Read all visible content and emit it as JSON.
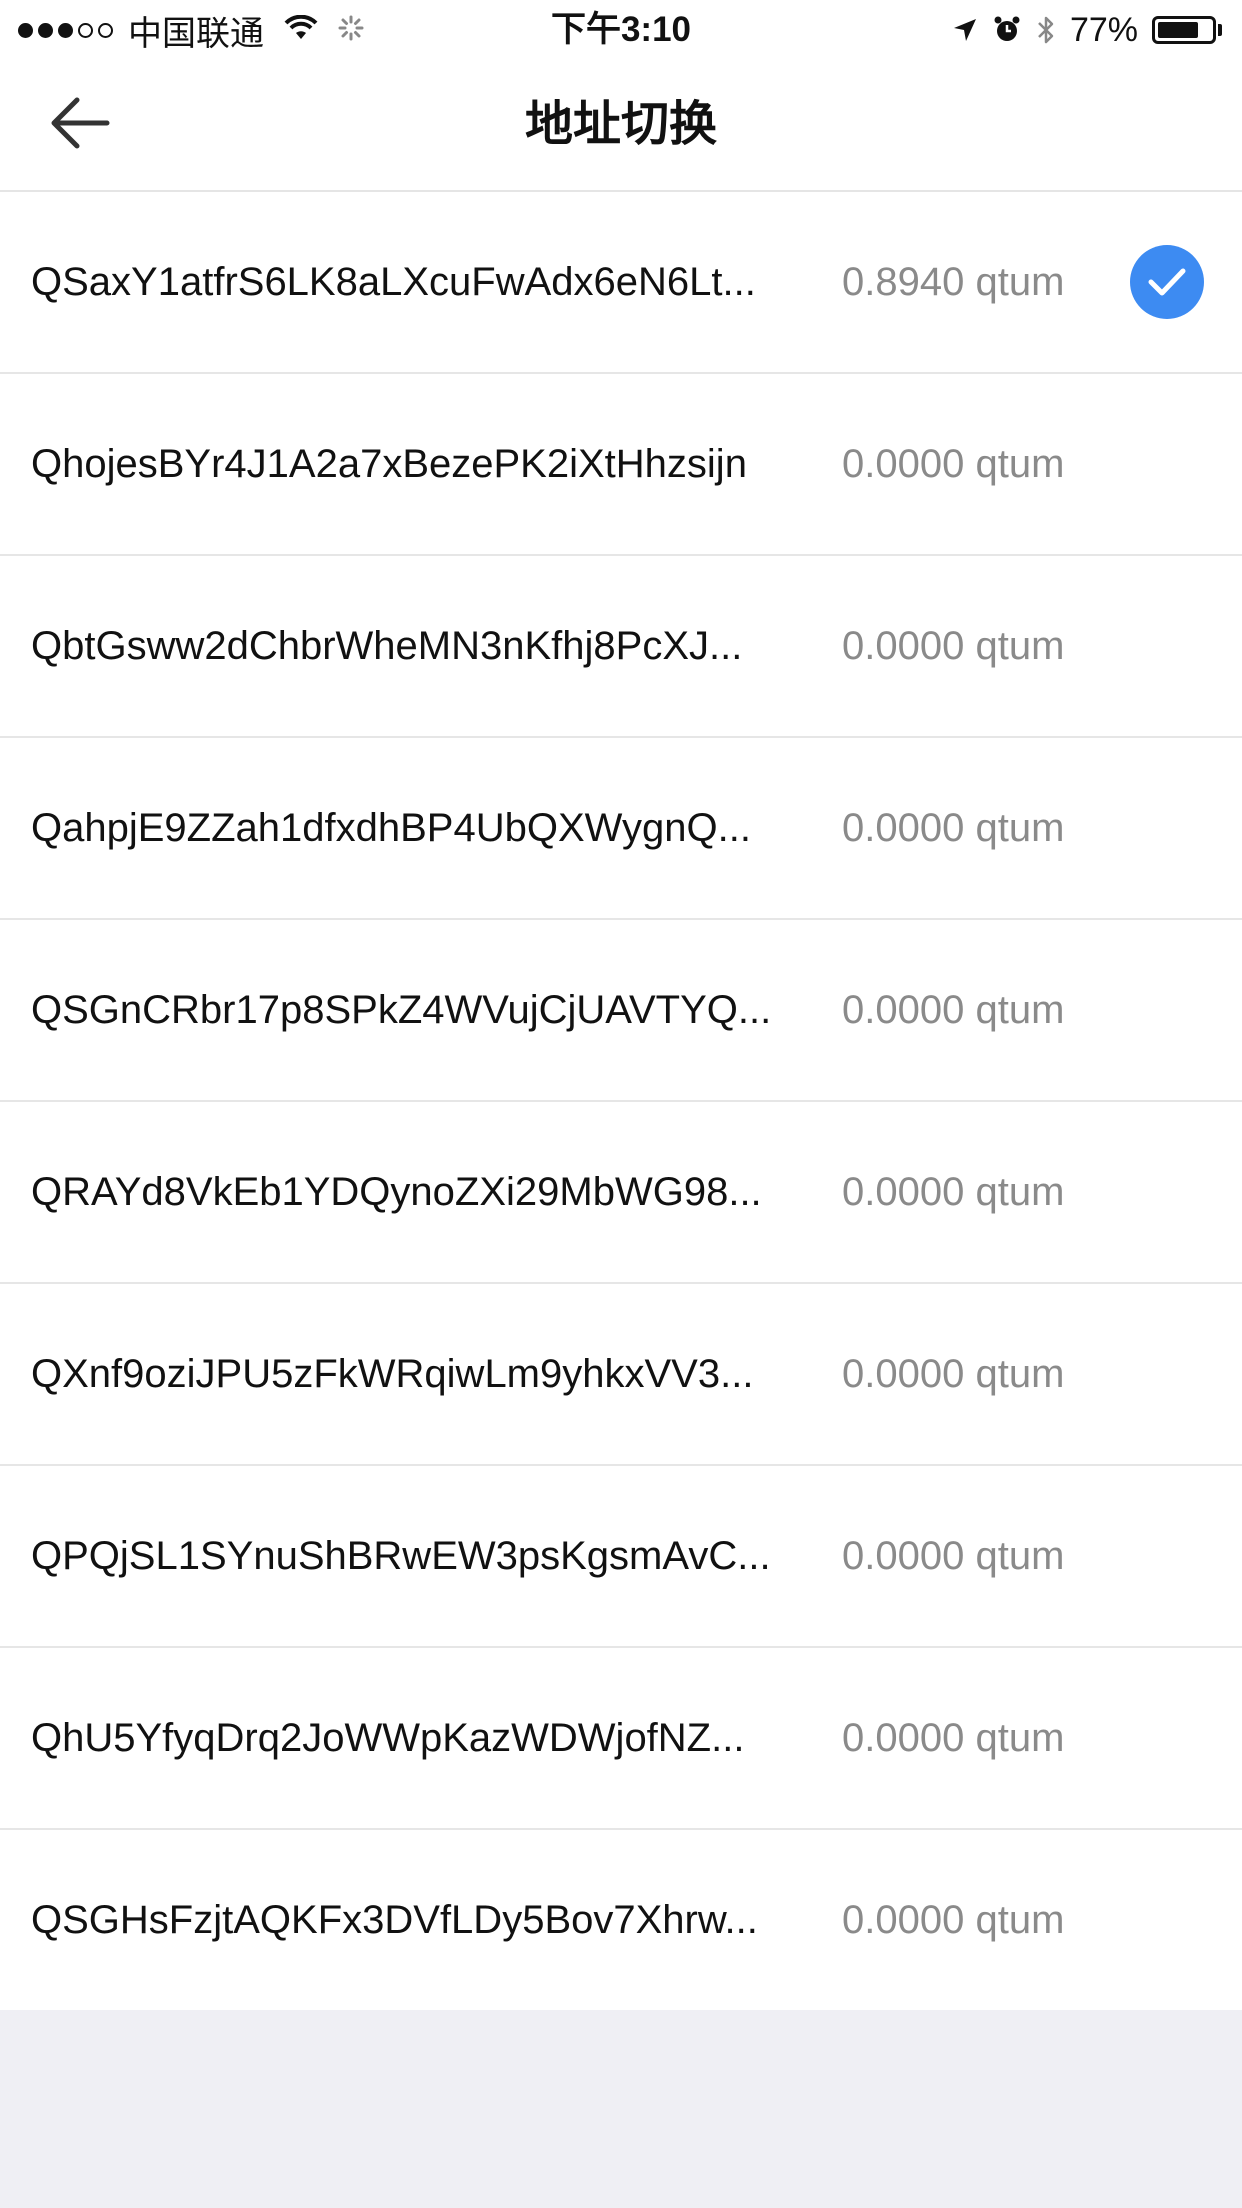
{
  "status_bar": {
    "carrier": "中国联通",
    "time": "下午3:10",
    "battery_text": "77%",
    "battery_level": 0.77,
    "signal_bars_filled": 3,
    "signal_bars_total": 5
  },
  "nav": {
    "title": "地址切换",
    "back_icon": "arrow-left-icon"
  },
  "colors": {
    "accent": "#3d8bf2",
    "background": "#efeff4",
    "balance_text": "#8a8a8a"
  },
  "addresses": [
    {
      "address": "QSaxY1atfrS6LK8aLXcuFwAdx6eN6Lt...",
      "balance": "0.8940 qtum",
      "selected": true
    },
    {
      "address": "QhojesBYr4J1A2a7xBezePK2iXtHhzsijn",
      "balance": "0.0000 qtum",
      "selected": false
    },
    {
      "address": "QbtGsww2dChbrWheMN3nKfhj8PcXJ...",
      "balance": "0.0000 qtum",
      "selected": false
    },
    {
      "address": "QahpjE9ZZah1dfxdhBP4UbQXWygnQ...",
      "balance": "0.0000 qtum",
      "selected": false
    },
    {
      "address": "QSGnCRbr17p8SPkZ4WVujCjUAVTYQ...",
      "balance": "0.0000 qtum",
      "selected": false
    },
    {
      "address": "QRAYd8VkEb1YDQynoZXi29MbWG98...",
      "balance": "0.0000 qtum",
      "selected": false
    },
    {
      "address": "QXnf9oziJPU5zFkWRqiwLm9yhkxVV3...",
      "balance": "0.0000 qtum",
      "selected": false
    },
    {
      "address": "QPQjSL1SYnuShBRwEW3psKgsmAvC...",
      "balance": "0.0000 qtum",
      "selected": false
    },
    {
      "address": "QhU5YfyqDrq2JoWWpKazWDWjofNZ...",
      "balance": "0.0000 qtum",
      "selected": false
    },
    {
      "address": "QSGHsFzjtAQKFx3DVfLDy5Bov7Xhrw...",
      "balance": "0.0000 qtum",
      "selected": false
    }
  ]
}
